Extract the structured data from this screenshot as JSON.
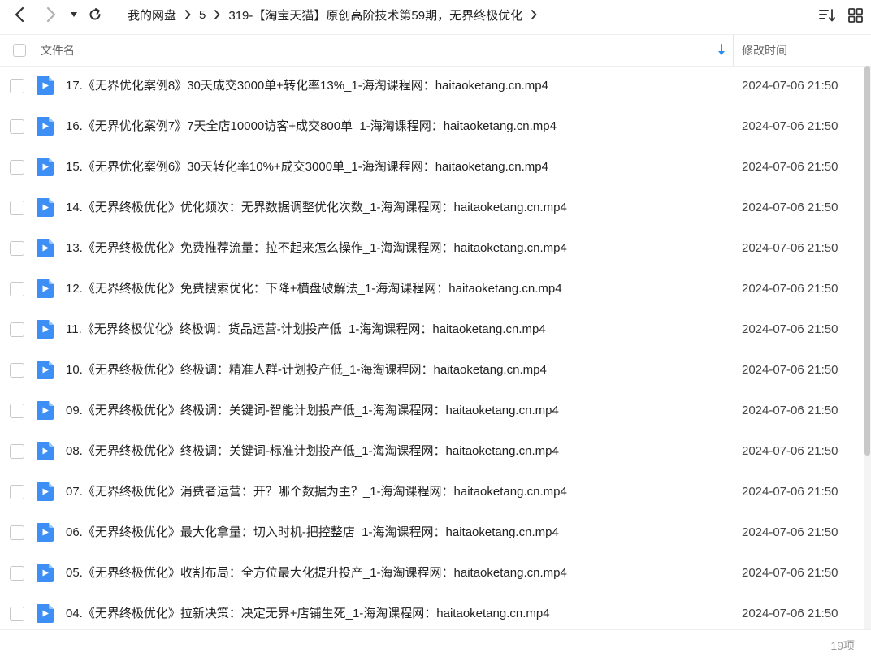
{
  "breadcrumb": [
    {
      "label": "我的网盘"
    },
    {
      "label": "5"
    },
    {
      "label": "319-【淘宝天猫】原创高阶技术第59期，无界终极优化"
    }
  ],
  "header": {
    "name_label": "文件名",
    "time_label": "修改时间"
  },
  "files": [
    {
      "name": "17.《无界优化案例8》30天成交3000单+转化率13%_1-海淘课程网：haitaoketang.cn.mp4",
      "modified": "2024-07-06 21:50"
    },
    {
      "name": "16.《无界优化案例7》7天全店10000访客+成交800单_1-海淘课程网：haitaoketang.cn.mp4",
      "modified": "2024-07-06 21:50"
    },
    {
      "name": "15.《无界优化案例6》30天转化率10%+成交3000单_1-海淘课程网：haitaoketang.cn.mp4",
      "modified": "2024-07-06 21:50"
    },
    {
      "name": "14.《无界终极优化》优化频次：无界数据调整优化次数_1-海淘课程网：haitaoketang.cn.mp4",
      "modified": "2024-07-06 21:50"
    },
    {
      "name": "13.《无界终极优化》免费推荐流量：拉不起来怎么操作_1-海淘课程网：haitaoketang.cn.mp4",
      "modified": "2024-07-06 21:50"
    },
    {
      "name": "12.《无界终极优化》免费搜索优化：下降+横盘破解法_1-海淘课程网：haitaoketang.cn.mp4",
      "modified": "2024-07-06 21:50"
    },
    {
      "name": "11.《无界终极优化》终极调：货品运营-计划投产低_1-海淘课程网：haitaoketang.cn.mp4",
      "modified": "2024-07-06 21:50"
    },
    {
      "name": "10.《无界终极优化》终极调：精准人群-计划投产低_1-海淘课程网：haitaoketang.cn.mp4",
      "modified": "2024-07-06 21:50"
    },
    {
      "name": "09.《无界终极优化》终极调：关键词-智能计划投产低_1-海淘课程网：haitaoketang.cn.mp4",
      "modified": "2024-07-06 21:50"
    },
    {
      "name": "08.《无界终极优化》终极调：关键词-标准计划投产低_1-海淘课程网：haitaoketang.cn.mp4",
      "modified": "2024-07-06 21:50"
    },
    {
      "name": "07.《无界终极优化》消费者运营：开？哪个数据为主？_1-海淘课程网：haitaoketang.cn.mp4",
      "modified": "2024-07-06 21:50"
    },
    {
      "name": "06.《无界终极优化》最大化拿量：切入时机-把控整店_1-海淘课程网：haitaoketang.cn.mp4",
      "modified": "2024-07-06 21:50"
    },
    {
      "name": "05.《无界终极优化》收割布局：全方位最大化提升投产_1-海淘课程网：haitaoketang.cn.mp4",
      "modified": "2024-07-06 21:50"
    },
    {
      "name": "04.《无界终极优化》拉新决策：决定无界+店铺生死_1-海淘课程网：haitaoketang.cn.mp4",
      "modified": "2024-07-06 21:50"
    }
  ],
  "footer": {
    "count": "19项"
  },
  "icons": {
    "back": "chevron-left-icon",
    "forward": "chevron-right-icon",
    "history": "caret-down-icon",
    "refresh": "refresh-icon",
    "sort": "sort-icon",
    "view": "grid-view-icon",
    "file": "video-file-icon"
  },
  "colors": {
    "accent": "#2b8cf3",
    "file_icon": "#3d8ff5"
  }
}
